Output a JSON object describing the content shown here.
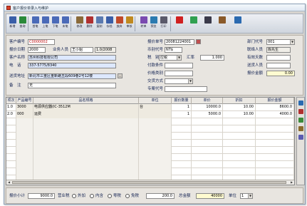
{
  "window": {
    "title": "客户报价单录入与维护"
  },
  "toolbar": {
    "buttons": [
      {
        "label": "新增",
        "icon": "new-doc-icon",
        "color": "#3a5fa8"
      },
      {
        "label": "查询",
        "icon": "find-icon",
        "color": "#2a8a3a"
      },
      {
        "label": "首笔",
        "icon": "first-record-icon",
        "color": "#4a6ab8"
      },
      {
        "label": "上笔",
        "icon": "prev-record-icon",
        "color": "#4a6ab8"
      },
      {
        "label": "下笔",
        "icon": "next-record-icon",
        "color": "#4a6ab8"
      },
      {
        "label": "末笔",
        "icon": "last-record-icon",
        "color": "#4a6ab8"
      },
      {
        "label": "修改",
        "icon": "edit-icon",
        "color": "#8a6a3a"
      },
      {
        "label": "删除",
        "icon": "delete-icon",
        "color": "#b03030"
      },
      {
        "label": "复制",
        "icon": "copy-icon",
        "color": "#5a7ab0"
      },
      {
        "label": "存档",
        "icon": "save-icon",
        "color": "#3a5fa8"
      },
      {
        "label": "放弃",
        "icon": "cancel-icon",
        "color": "#c04a2a"
      },
      {
        "label": "审核",
        "icon": "approve-icon",
        "color": "#c08a20"
      },
      {
        "label": "转单",
        "icon": "convert-icon",
        "color": "#7a4ab0"
      },
      {
        "label": "预览",
        "icon": "preview-icon",
        "color": "#2a7ab0"
      },
      {
        "label": "打印",
        "icon": "print-icon",
        "color": "#5a5a6a"
      },
      {
        "label": "",
        "icon": "record-dot-icon",
        "color": "#d02020"
      },
      {
        "label": "",
        "icon": "filter-icon",
        "color": "#30a050"
      },
      {
        "label": "",
        "icon": "attach-icon",
        "color": "#3a3a4a"
      },
      {
        "label": "",
        "icon": "tools-icon",
        "color": "#8a5a2a"
      },
      {
        "label": "",
        "icon": "exit-icon",
        "color": "#2a6ab0"
      }
    ]
  },
  "header": {
    "customer_code_label": "客户编号",
    "customer_code_value": "C0000002",
    "code2_label": "报价日期",
    "code2_value": "2000",
    "sales_label": "业务人员",
    "sales_value": "王小姐",
    "sales_date_value": "1.0/2008",
    "customer_name_label": "客户名称",
    "customer_name_value": "苏州科技有限公司",
    "phone_label": "电　话",
    "phone_value": "337-5775/8340",
    "address_label": "送货地址",
    "address_value": "新北市三重区重新路五段609巷2号12楼",
    "remark_label": "备　注",
    "remark_value": "无",
    "quote_no_label": "报价单号",
    "quote_no_value": "20081224001",
    "currency_label": "币别代号",
    "currency_value": "NT$",
    "tax_label": "税　别",
    "tax_value": "应税",
    "rate_label": "汇率",
    "rate_value": "1.000",
    "terms_label": "付款条件",
    "terms_value": "",
    "price_type_label": "价格类别",
    "price_type_value": "",
    "delivery_label": "交货方式",
    "delivery_value": "",
    "contact_label": "联络人员",
    "contact_value": "陈先生",
    "valid_label": "有效天数",
    "valid_value": "",
    "project_label": "专案代号",
    "project_value": "",
    "ship_to_label": "送货人员",
    "ship_to_value": "",
    "amount_label": "报价金额",
    "amount_value": "0.00",
    "dept_label": "部门代号",
    "dept_value": "001"
  },
  "grid": {
    "columns": [
      "项次",
      "产品编号",
      "品名规格",
      "单位",
      "报价数量",
      "单价",
      "折扣",
      "报价金额"
    ],
    "rows": [
      {
        "seq": "1.0",
        "code": "3000",
        "name": "电源供应器(IC-3512M",
        "unit": "台",
        "qty": "1",
        "price": "10000.0",
        "disc": "10.00",
        "amount": "8600.0"
      },
      {
        "seq": "2.0",
        "code": "000",
        "name": "运费",
        "unit": "",
        "qty": "1",
        "price": "5000.0",
        "disc": "10.00",
        "amount": "4000.0"
      }
    ],
    "empty_rows": 10
  },
  "sidebar": {
    "icons": [
      {
        "name": "row-insert-icon",
        "color": "#2a6ab0"
      },
      {
        "name": "row-delete-icon",
        "color": "#b03030"
      },
      {
        "name": "row-copy-icon",
        "color": "#3a8a3a"
      },
      {
        "name": "row-detail-icon",
        "color": "#8a6a2a"
      },
      {
        "name": "row-search-icon",
        "color": "#5a5ab0"
      }
    ]
  },
  "footer": {
    "total_label": "报价小计",
    "total_value": "9000.0",
    "tax_option_label": "营业税",
    "tax_options": [
      "外加",
      "内含",
      "零税",
      "免税"
    ],
    "tax_amount_value": "200.0",
    "grand_total_label": "总金额",
    "grand_total_value": "40000",
    "unit_label": "单位",
    "unit_value": "1"
  }
}
